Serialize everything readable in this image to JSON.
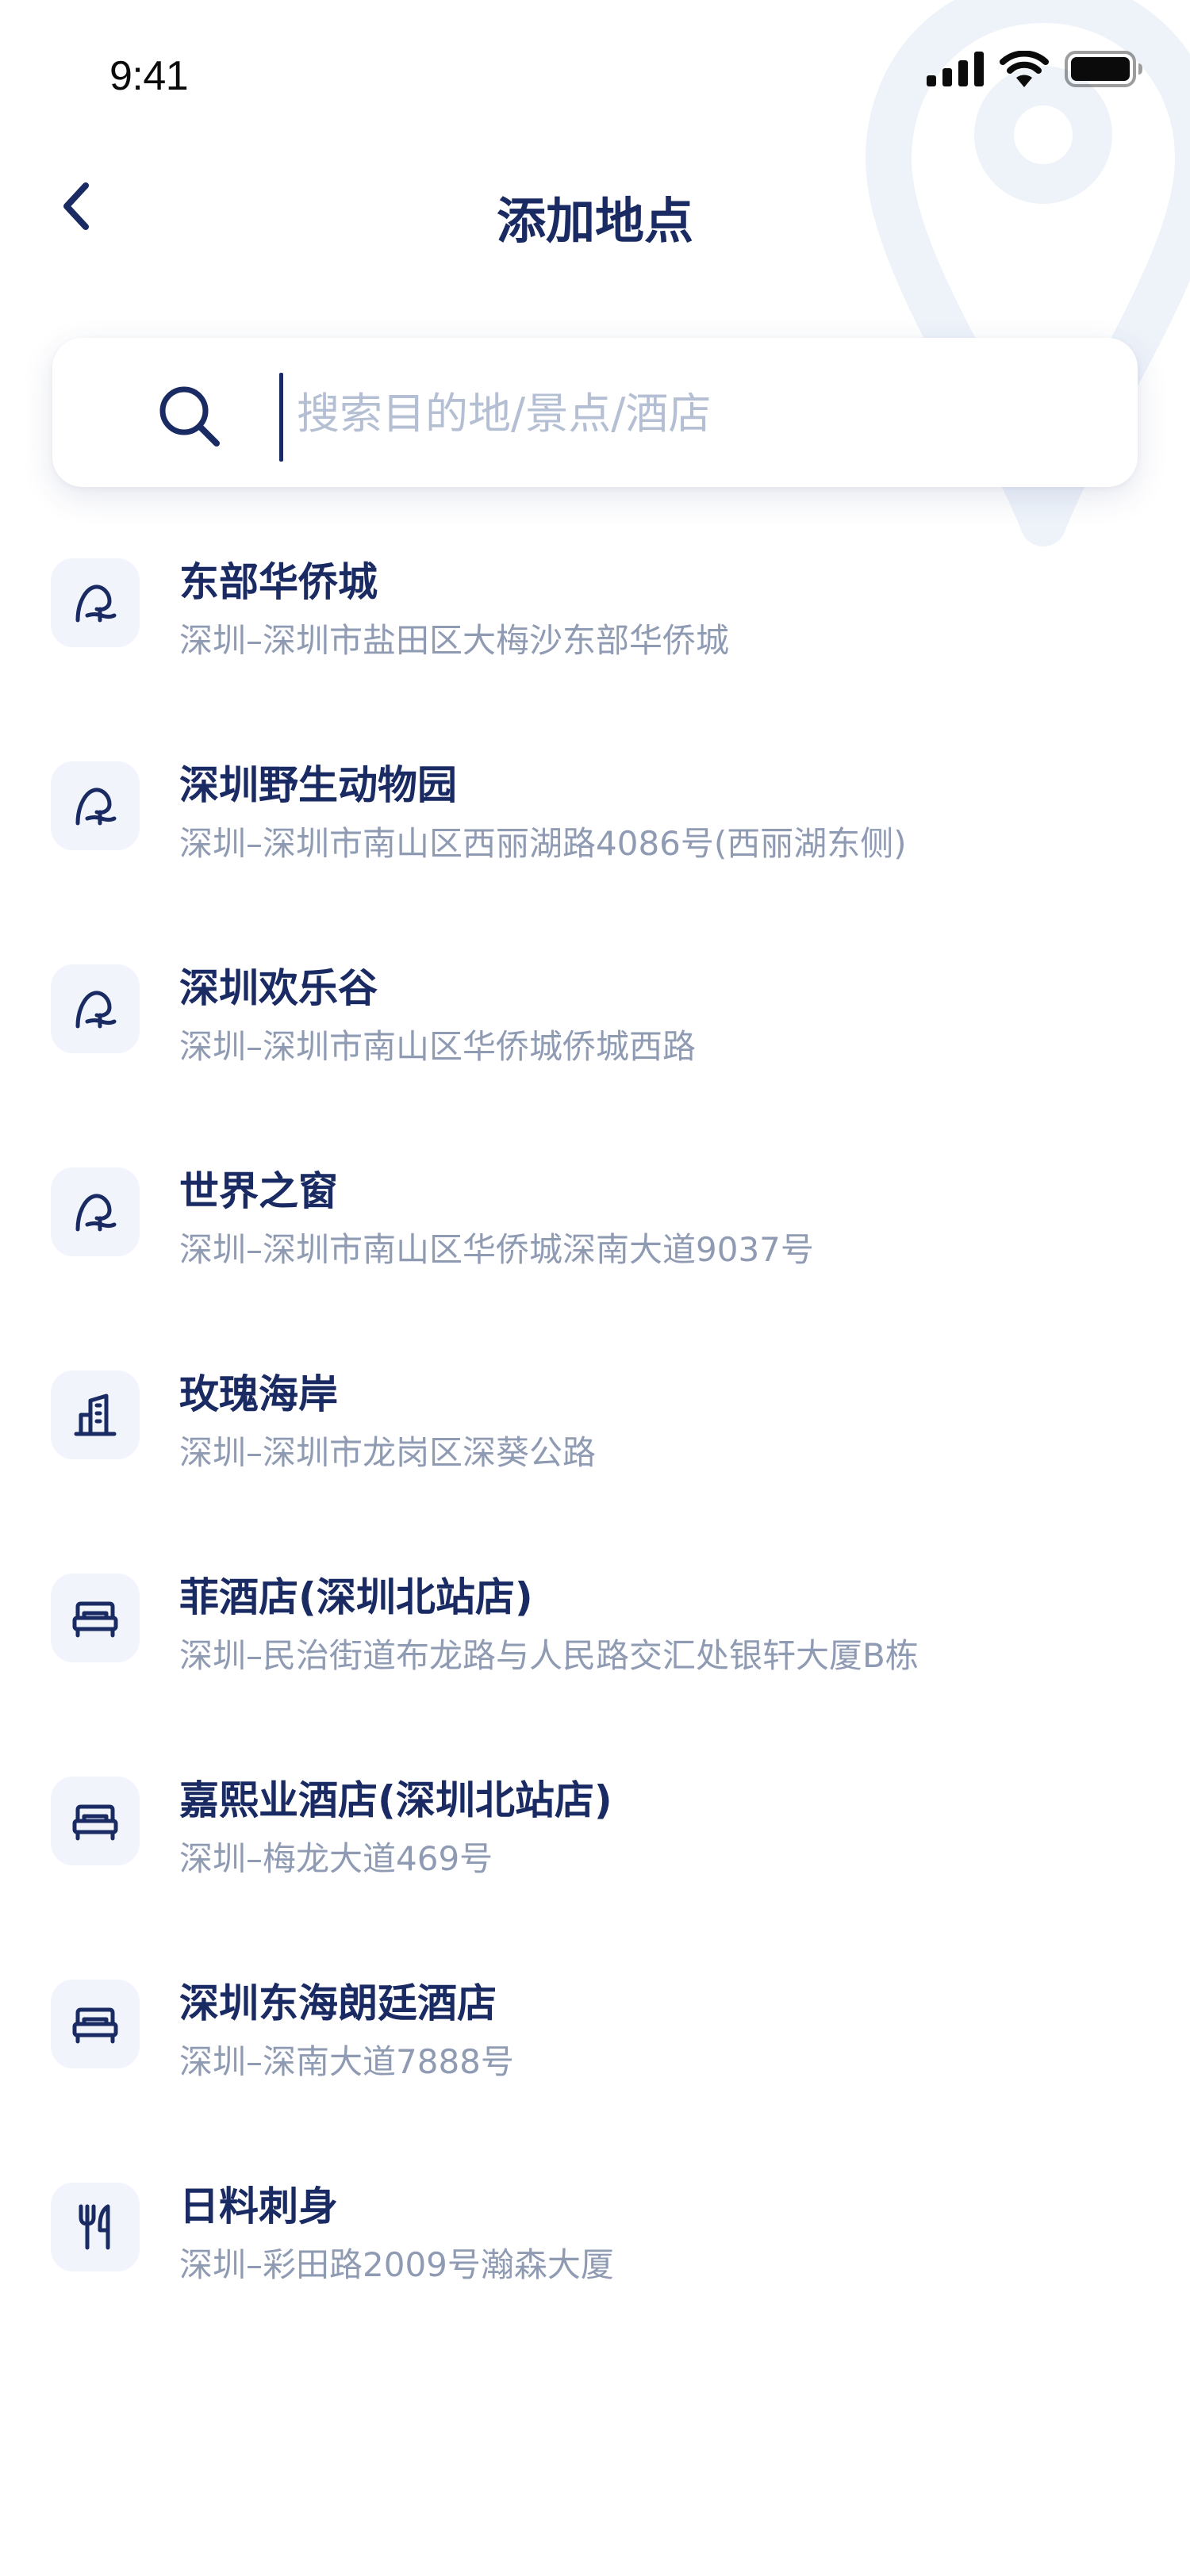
{
  "status_bar": {
    "time": "9:41",
    "icons": [
      "signal-icon",
      "wifi-icon",
      "battery-icon"
    ]
  },
  "nav": {
    "back_icon": "chevron-left-icon",
    "title": "添加地点"
  },
  "search": {
    "icon": "search-icon",
    "placeholder": "搜索目的地/景点/酒店",
    "value": ""
  },
  "places": [
    {
      "icon": "attraction-icon",
      "name": "东部华侨城",
      "address": "深圳–深圳市盐田区大梅沙东部华侨城"
    },
    {
      "icon": "attraction-icon",
      "name": "深圳野生动物园",
      "address": "深圳–深圳市南山区西丽湖路4086号(西丽湖东侧)"
    },
    {
      "icon": "attraction-icon",
      "name": "深圳欢乐谷",
      "address": "深圳–深圳市南山区华侨城侨城西路"
    },
    {
      "icon": "attraction-icon",
      "name": "世界之窗",
      "address": "深圳–深圳市南山区华侨城深南大道9037号"
    },
    {
      "icon": "building-icon",
      "name": "玫瑰海岸",
      "address": "深圳–深圳市龙岗区深葵公路"
    },
    {
      "icon": "bed-icon",
      "name": "菲酒店(深圳北站店)",
      "address": "深圳–民治街道布龙路与人民路交汇处银轩大厦B栋"
    },
    {
      "icon": "bed-icon",
      "name": "嘉熙业酒店(深圳北站店)",
      "address": "深圳–梅龙大道469号"
    },
    {
      "icon": "bed-icon",
      "name": "深圳东海朗廷酒店",
      "address": "深圳–深南大道7888号"
    },
    {
      "icon": "restaurant-icon",
      "name": "日料刺身",
      "address": "深圳–彩田路2009号瀚森大厦"
    }
  ],
  "colors": {
    "primary": "#1a2a63",
    "secondary_text": "#8f9ab3",
    "placeholder": "#b5bfd3",
    "icon_bg": "#f1f5fb",
    "watermark": "#eef3fa"
  }
}
